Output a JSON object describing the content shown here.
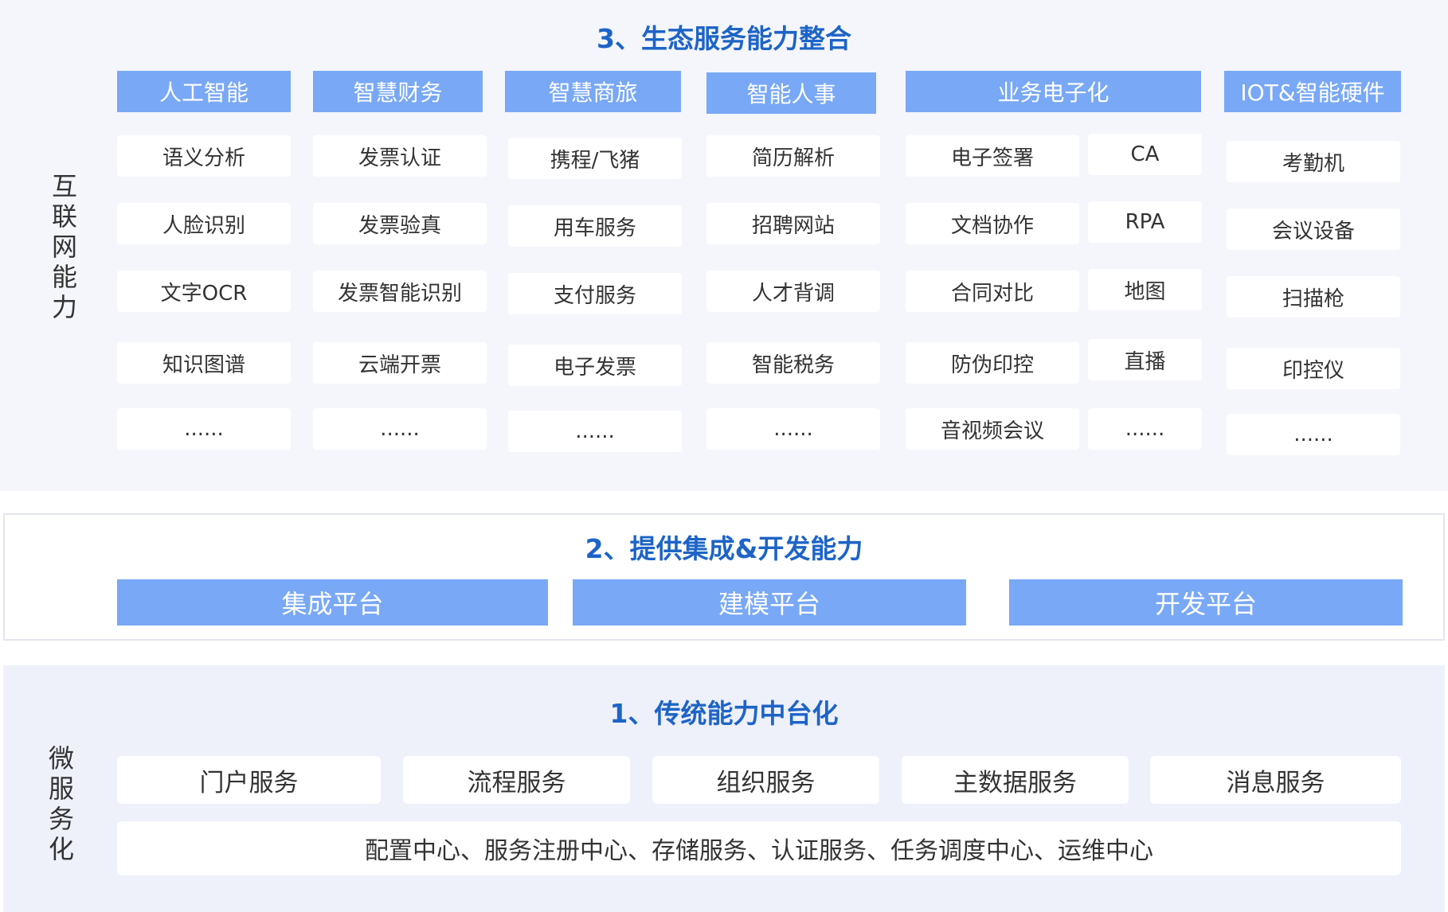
{
  "sections": {
    "ecosystem": {
      "title": "3、生态服务能力整合",
      "side_label": [
        "互",
        "联",
        "网",
        "能",
        "力"
      ],
      "columns": [
        {
          "header": "人工智能",
          "items": [
            "语义分析",
            "人脸识别",
            "文字OCR",
            "知识图谱",
            "......"
          ]
        },
        {
          "header": "智慧财务",
          "items": [
            "发票认证",
            "发票验真",
            "发票智能识别",
            "云端开票",
            "......"
          ]
        },
        {
          "header": "智慧商旅",
          "items": [
            "携程/飞猪",
            "用车服务",
            "支付服务",
            "电子发票",
            "......"
          ]
        },
        {
          "header": "智能人事",
          "items": [
            "简历解析",
            "招聘网站",
            "人才背调",
            "智能税务",
            "......"
          ]
        },
        {
          "header": "业务电子化",
          "items_left": [
            "电子签署",
            "文档协作",
            "合同对比",
            "防伪印控",
            "音视频会议"
          ],
          "items_right": [
            "CA",
            "RPA",
            "地图",
            "直播",
            "......"
          ]
        },
        {
          "header": "IOT&智能硬件",
          "items": [
            "考勤机",
            "会议设备",
            "扫描枪",
            "印控仪",
            "......"
          ]
        }
      ]
    },
    "integration": {
      "title": "2、提供集成&开发能力",
      "platforms": [
        "集成平台",
        "建模平台",
        "开发平台"
      ]
    },
    "traditional": {
      "title": "1、传统能力中台化",
      "side_label": [
        "微",
        "服",
        "务",
        "化"
      ],
      "services": [
        "门户服务",
        "流程服务",
        "组织服务",
        "主数据服务",
        "消息服务"
      ],
      "infrastructure": "配置中心、服务注册中心、存储服务、认证服务、任务调度中心、运维中心"
    }
  },
  "colors": {
    "accent": "#79a8f6",
    "title": "#1d64c7",
    "panel_top": "#f5f6fc",
    "panel_bottom": "#eef0fa"
  }
}
